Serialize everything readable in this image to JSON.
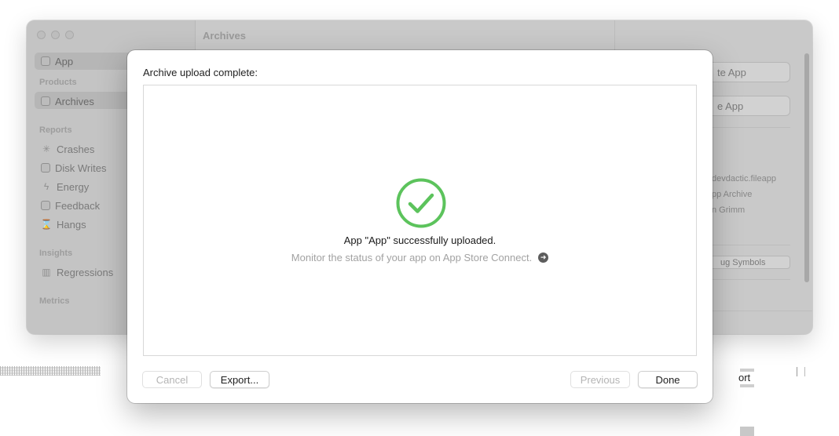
{
  "background_window": {
    "main_title": "Archives",
    "sidebar": {
      "app_item": "App",
      "sections": [
        {
          "header": "Products",
          "items": [
            {
              "label": "Archives",
              "icon": "archive-icon"
            }
          ]
        },
        {
          "header": "Reports",
          "items": [
            {
              "label": "Crashes",
              "icon": "crash-icon"
            },
            {
              "label": "Disk Writes",
              "icon": "disk-icon"
            },
            {
              "label": "Energy",
              "icon": "energy-icon"
            },
            {
              "label": "Feedback",
              "icon": "feedback-icon"
            },
            {
              "label": "Hangs",
              "icon": "hourglass-icon"
            }
          ]
        },
        {
          "header": "Insights",
          "items": [
            {
              "label": "Regressions",
              "icon": "chart-icon"
            }
          ]
        },
        {
          "header": "Metrics",
          "items": []
        }
      ]
    },
    "inspector": {
      "button1": "te App",
      "button2": "e App",
      "lines": [
        "devdactic.fileapp",
        "pp Archive",
        "n Grimm"
      ],
      "debug_button": "ug Symbols"
    }
  },
  "sheet": {
    "title": "Archive upload complete:",
    "success_message": "App \"App\" successfully uploaded.",
    "monitor_message": "Monitor the status of your app on App Store Connect.",
    "buttons": {
      "cancel": "Cancel",
      "export": "Export...",
      "previous": "Previous",
      "done": "Done"
    },
    "colors": {
      "success_green": "#5cc35c",
      "arrow_gray": "#5d5d5d"
    }
  },
  "fragments": {
    "partial_text": "ort"
  }
}
